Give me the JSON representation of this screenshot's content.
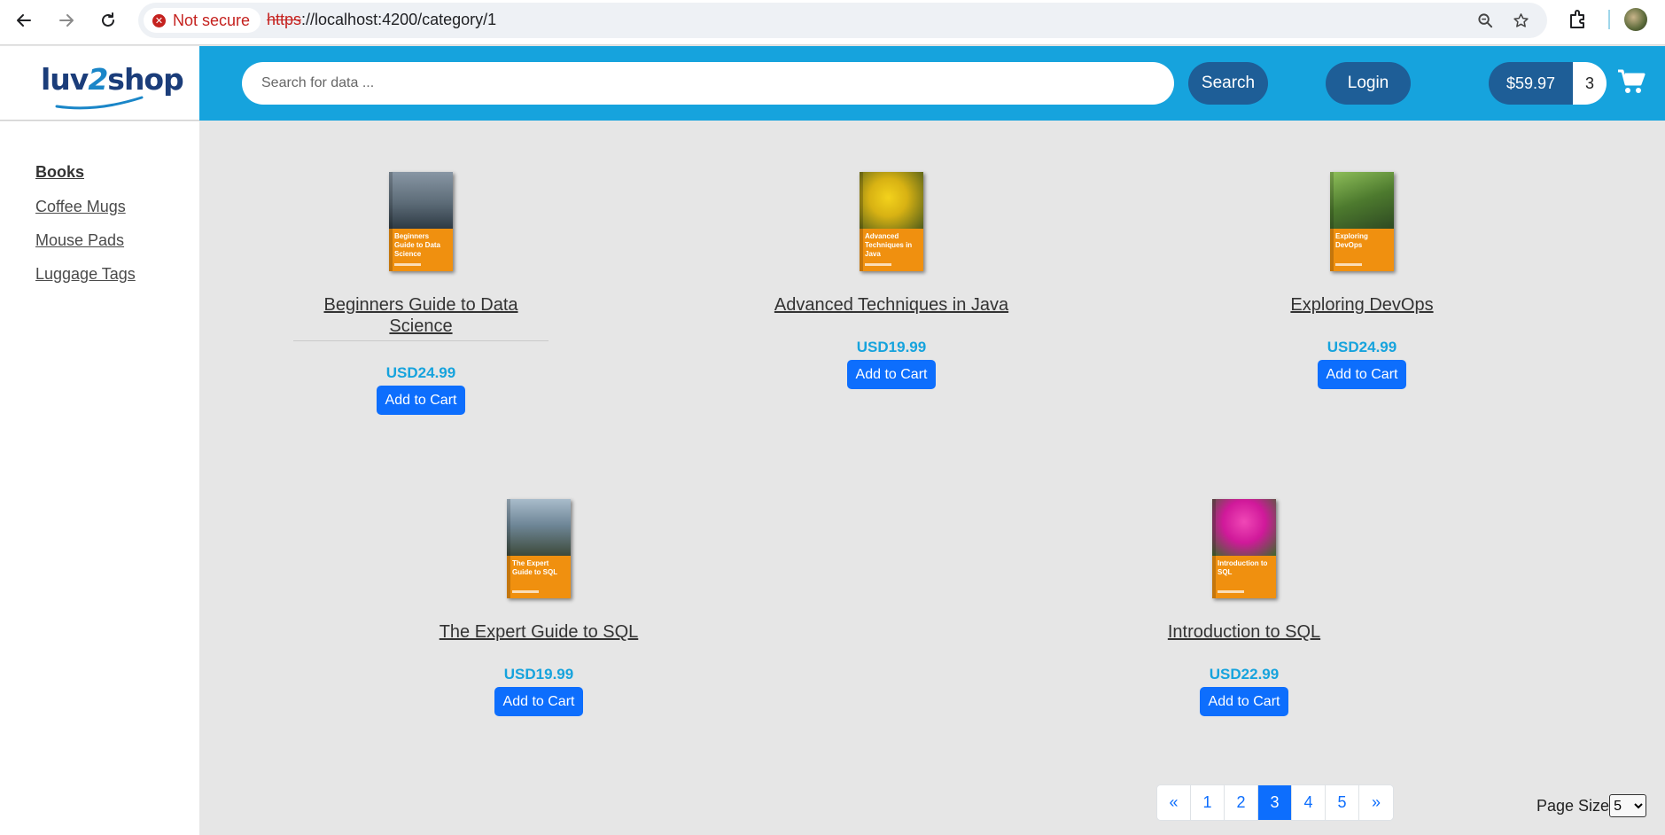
{
  "browser": {
    "security_label": "Not secure",
    "url_protocol": "https",
    "url_rest": "://localhost:4200/category/1"
  },
  "header": {
    "logo_part1": "luv",
    "logo_part2": "2",
    "logo_part3": "shop",
    "search_placeholder": "Search for data ...",
    "search_button": "Search",
    "login_button": "Login",
    "cart_total": "$59.97",
    "cart_quantity": "3"
  },
  "sidebar": {
    "categories": [
      {
        "label": "Books",
        "active": true
      },
      {
        "label": "Coffee Mugs",
        "active": false
      },
      {
        "label": "Mouse Pads",
        "active": false
      },
      {
        "label": "Luggage Tags",
        "active": false
      }
    ]
  },
  "products": [
    {
      "name_line1": "Beginners Guide to Data",
      "name_line2": "Science",
      "cover_text": "Beginners Guide to Data Science",
      "price": "USD24.99",
      "button": "Add to Cart",
      "cover_colors": [
        "#6f7f8f",
        "#2e3a44"
      ]
    },
    {
      "name_line1": "Advanced Techniques in Java",
      "name_line2": "",
      "cover_text": "Advanced Techniques in Java",
      "price": "USD19.99",
      "button": "Add to Cart",
      "cover_colors": [
        "#e8c21a",
        "#4f5d1a"
      ]
    },
    {
      "name_line1": "Exploring DevOps",
      "name_line2": "",
      "cover_text": "Exploring DevOps",
      "price": "USD24.99",
      "button": "Add to Cart",
      "cover_colors": [
        "#5f8f3a",
        "#2e4a22"
      ]
    },
    {
      "name_line1": "The Expert Guide to SQL",
      "name_line2": "",
      "cover_text": "The Expert Guide to SQL",
      "price": "USD19.99",
      "button": "Add to Cart",
      "cover_colors": [
        "#8aa5b8",
        "#3d4a3a"
      ]
    },
    {
      "name_line1": "Introduction to SQL",
      "name_line2": "",
      "cover_text": "Introduction to SQL",
      "price": "USD22.99",
      "button": "Add to Cart",
      "cover_colors": [
        "#d0199a",
        "#3d6a2a"
      ]
    }
  ],
  "pagination": {
    "first": "«",
    "pages": [
      "1",
      "2",
      "3",
      "4",
      "5"
    ],
    "active_page": "3",
    "last": "»",
    "page_size_label": "Page Size",
    "page_size_value": "5"
  },
  "colors": {
    "topbar": "#16a3dd",
    "pill": "#1e5e97",
    "primary": "#0d6efd",
    "price": "#16a3dd",
    "not_secure": "#c5221f"
  }
}
